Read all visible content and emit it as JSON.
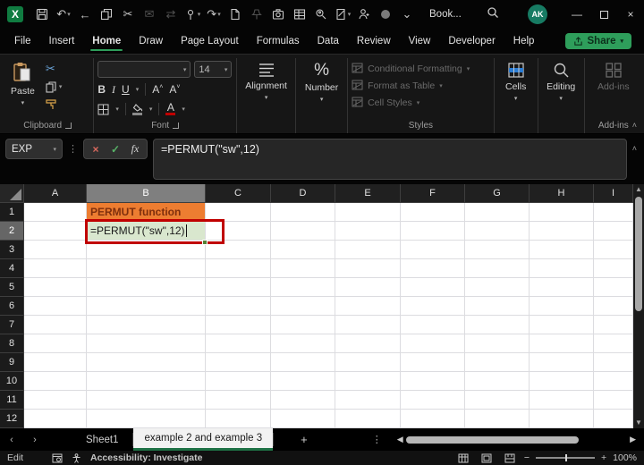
{
  "titlebar": {
    "excel_logo": "X",
    "qat": [
      {
        "name": "save-icon"
      },
      {
        "name": "undo-icon",
        "chevron": true
      },
      {
        "name": "back-arrow-icon"
      },
      {
        "name": "copy-icon"
      },
      {
        "name": "cut-icon"
      },
      {
        "name": "mail-icon",
        "disabled": true
      },
      {
        "name": "replace-icon",
        "disabled": true
      },
      {
        "name": "touch-mode-icon",
        "chevron": true
      },
      {
        "name": "redo-icon",
        "chevron": true
      },
      {
        "name": "new-file-icon"
      },
      {
        "name": "pin-icon",
        "disabled": true
      },
      {
        "name": "camera-icon"
      },
      {
        "name": "workbook-icon"
      },
      {
        "name": "search-person-icon"
      },
      {
        "name": "ink-doc-icon",
        "chevron": true
      },
      {
        "name": "person-add-icon"
      },
      {
        "name": "record-circle-icon"
      },
      {
        "name": "ribbon-options-icon"
      }
    ],
    "title": "Book...",
    "avatar": "AK",
    "minimize": "—",
    "close": "×"
  },
  "menubar": {
    "items": [
      "File",
      "Insert",
      "Home",
      "Draw",
      "Page Layout",
      "Formulas",
      "Data",
      "Review",
      "View",
      "Developer",
      "Help"
    ],
    "active": "Home",
    "share_label": "Share"
  },
  "ribbon": {
    "clipboard": {
      "label": "Clipboard",
      "paste_label": "Paste"
    },
    "font": {
      "label": "Font",
      "font_name_value": "",
      "size_value": "14",
      "bold": "B",
      "italic": "I",
      "underline": "U",
      "grow": "A",
      "shrink": "A"
    },
    "alignment": {
      "label": "Alignment"
    },
    "number": {
      "label": "Number",
      "glyph": "%"
    },
    "styles": {
      "label": "Styles",
      "items": [
        "Conditional Formatting",
        "Format as Table",
        "Cell Styles"
      ]
    },
    "cells": {
      "label": "Cells"
    },
    "editing": {
      "label": "Editing"
    },
    "addins": {
      "button_label": "Add-ins",
      "label": "Add-ins"
    }
  },
  "formula_bar": {
    "name_box": "EXP",
    "fx_label": "fx",
    "cancel_glyph": "×",
    "enter_glyph": "✓",
    "formula": "=PERMUT(\"sw\",12)"
  },
  "grid": {
    "columns": [
      "A",
      "B",
      "C",
      "D",
      "E",
      "F",
      "G",
      "H",
      "I"
    ],
    "rows": 12,
    "selected_column": "B",
    "selected_row": 2,
    "cells": {
      "B1": {
        "text": "PERMUT function",
        "bg": "#ED7D31",
        "color": "#7E2F0D",
        "bold": true
      },
      "B2": {
        "text": "=PERMUT(\"sw\",12)",
        "bg": "#D9E7CE",
        "color": "#1a1a1a",
        "editing": true
      }
    },
    "annotation_color": "#C00000"
  },
  "sheet_tabs": {
    "tabs": [
      {
        "label": "Sheet1",
        "active": false
      },
      {
        "label": "example 2 and example 3",
        "active": true
      }
    ],
    "add_label": "+"
  },
  "status_bar": {
    "mode": "Edit",
    "accessibility": "Accessibility: Investigate",
    "zoom": "100%"
  },
  "colors": {
    "excel_green": "#107C41",
    "share_green": "#2E9E5B",
    "active_tab_underline": "#1E7145",
    "avatar_teal": "#177B63",
    "cell_b1_bg": "#ED7D31",
    "cell_b1_text": "#7E2F0D",
    "cell_b2_bg": "#D9E7CE",
    "annotation_red": "#C00000"
  }
}
